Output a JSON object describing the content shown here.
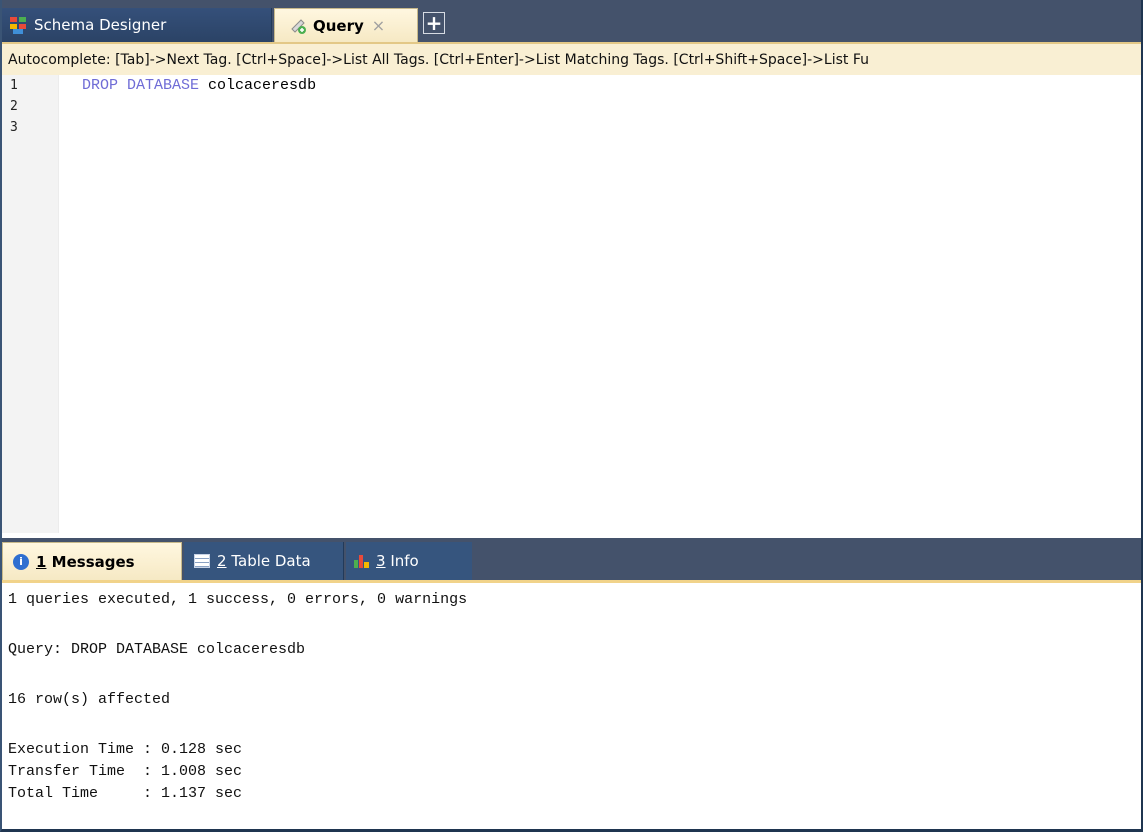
{
  "tabs": [
    {
      "label": "Schema Designer",
      "icon": "schema-designer-icon",
      "active": false
    },
    {
      "label": "Query",
      "icon": "query-icon",
      "active": true,
      "close": "×"
    },
    {
      "label": "+",
      "icon": "add-tab-icon"
    }
  ],
  "hint": "Autocomplete: [Tab]->Next Tag. [Ctrl+Space]->List All Tags. [Ctrl+Enter]->List Matching Tags. [Ctrl+Shift+Space]->List Fu",
  "editor": {
    "line_numbers": [
      "1",
      "2",
      "3"
    ],
    "code_keyword": "DROP DATABASE",
    "code_identifier": "colcaceresdb"
  },
  "result_tabs": [
    {
      "number": "1",
      "label": "Messages",
      "icon": "info-icon",
      "active": true
    },
    {
      "number": "2",
      "label": "Table Data",
      "icon": "table-icon",
      "active": false
    },
    {
      "number": "3",
      "label": "Info",
      "icon": "info-chart-icon",
      "active": false
    }
  ],
  "messages": {
    "summary": "1 queries executed, 1 success, 0 errors, 0 warnings",
    "query": "Query: DROP DATABASE colcaceresdb",
    "affected": "16 row(s) affected",
    "execution_time": "Execution Time : 0.128 sec",
    "transfer_time": "Transfer Time  : 1.008 sec",
    "total_time": "Total Time     : 1.137 sec"
  },
  "colors": {
    "tabstrip": "#44526b",
    "active_tab": "#f6e9c4",
    "keyword": "#6f6cd6"
  }
}
